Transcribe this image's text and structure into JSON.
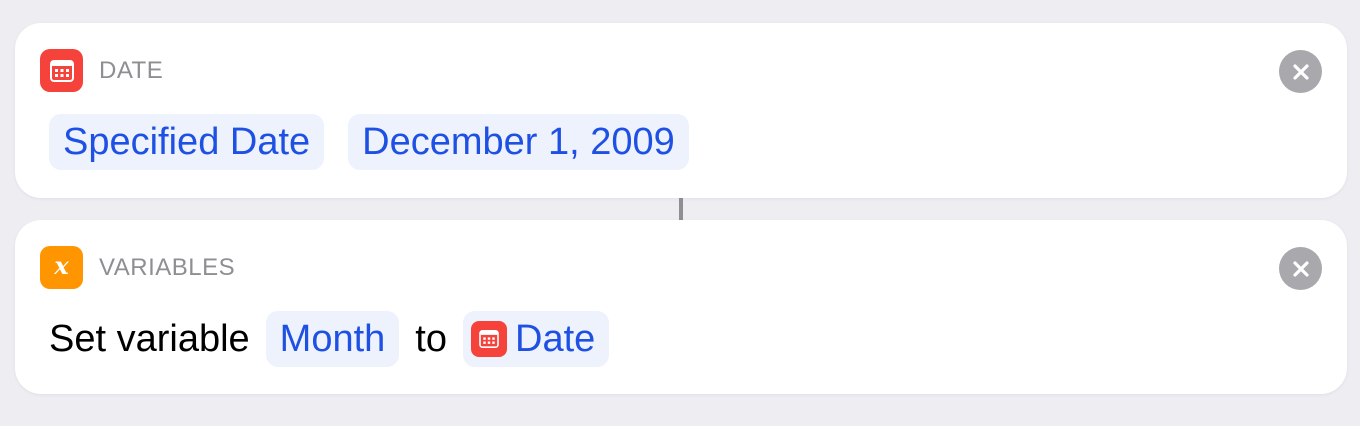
{
  "colors": {
    "background": "#EDEDF2",
    "card": "#FFFFFF",
    "token_text": "#1E50E3",
    "token_bg": "#EEF2FD",
    "date_icon": "#F5433B",
    "variables_icon": "#FF9500",
    "header_label": "#8E8E93",
    "close_button": "#A8A8AD"
  },
  "actions": [
    {
      "header": {
        "icon": "calendar-icon",
        "label": "DATE"
      },
      "close_icon": "close-icon",
      "params": [
        {
          "kind": "token",
          "text": "Specified Date"
        },
        {
          "kind": "token",
          "text": "December 1, 2009"
        }
      ]
    },
    {
      "header": {
        "icon": "variable-x-icon",
        "glyph": "x",
        "label": "VARIABLES"
      },
      "close_icon": "close-icon",
      "params": [
        {
          "kind": "text",
          "text": "Set variable"
        },
        {
          "kind": "token",
          "text": "Month"
        },
        {
          "kind": "text",
          "text": "to"
        },
        {
          "kind": "token",
          "icon": "calendar-icon",
          "text": "Date"
        }
      ]
    }
  ]
}
